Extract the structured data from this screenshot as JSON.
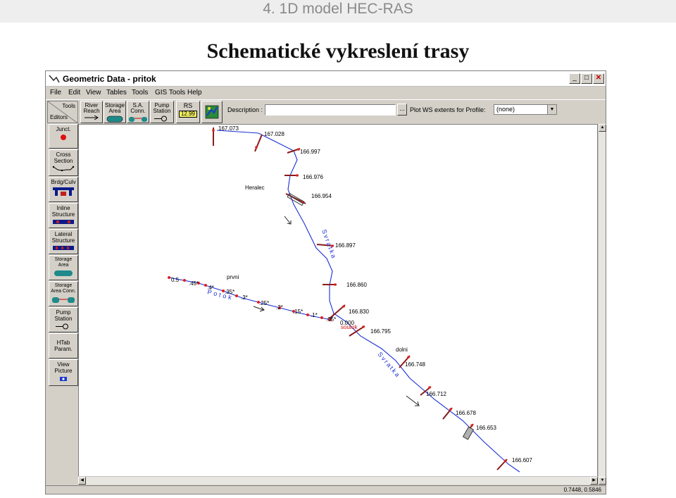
{
  "slide": {
    "header": "4.  1D model HEC-RAS",
    "title": "Schematické vykreslení trasy"
  },
  "window": {
    "title": "Geometric Data - pritok",
    "buttons": {
      "minimize": "_",
      "maximize": "□",
      "close": "✕"
    }
  },
  "menu": [
    "File",
    "Edit",
    "View",
    "Tables",
    "Tools",
    "GIS Tools",
    "Help"
  ],
  "toolbar": {
    "tools_label": "Tools",
    "editors_label": "Editors",
    "buttons": [
      {
        "label1": "River",
        "label2": "Reach"
      },
      {
        "label1": "Storage",
        "label2": "Area"
      },
      {
        "label1": "S.A.",
        "label2": "Conn."
      },
      {
        "label1": "Pump",
        "label2": "Station"
      },
      {
        "label1": "RS",
        "label2": "12.99"
      }
    ],
    "description_label": "Description :",
    "description_value": "",
    "dots_label": "...",
    "plot_label": "Plot WS extents for Profile:",
    "profile_value": "(none)"
  },
  "palette": [
    {
      "label": "Junct.",
      "icon": "junction-dot-icon"
    },
    {
      "label": "Cross Section",
      "icon": "cross-section-icon"
    },
    {
      "label": "Brdg/Culv",
      "icon": "bridge-icon"
    },
    {
      "label": "Inline Structure",
      "icon": "inline-structure-icon"
    },
    {
      "label": "Lateral Structure",
      "icon": "lateral-structure-icon"
    },
    {
      "label": "Storage Area",
      "icon": "storage-area-icon"
    },
    {
      "label": "Storage Area Conn.",
      "icon": "storage-area-conn-icon"
    },
    {
      "label": "Pump Station",
      "icon": "pump-station-icon"
    },
    {
      "label": "HTab Param.",
      "icon": ""
    },
    {
      "label": "View Picture",
      "icon": "camera-icon"
    }
  ],
  "map": {
    "labels": {
      "heralec": "Heralec",
      "prvni": "prvni",
      "dolni": "dolni",
      "soutok": "soutok",
      "potok": "Potok",
      "svratka_upper": "Svratka",
      "svratka_lower": "Svratka",
      "junction_value": "0.000"
    },
    "svratka_stations": [
      "167.073",
      "167.028",
      "166.997",
      "166.976",
      "166.954",
      "166.897",
      "166.860",
      "166.830",
      "166.795",
      "166.748",
      "166.712",
      "166.678",
      "166.653",
      "166.607"
    ],
    "pritok_stations": [
      "0.5",
      ".45*",
      ".4*",
      ".35*",
      ".3*",
      ".25*",
      ".2*",
      ".15*",
      ".1*",
      ".05*"
    ]
  },
  "status": {
    "coords": "0.7448, 0.5846"
  },
  "colors": {
    "river": "#1a2fd4",
    "section": "#8b1a1a",
    "section_dot": "#e02020",
    "label_red": "#d01010"
  }
}
